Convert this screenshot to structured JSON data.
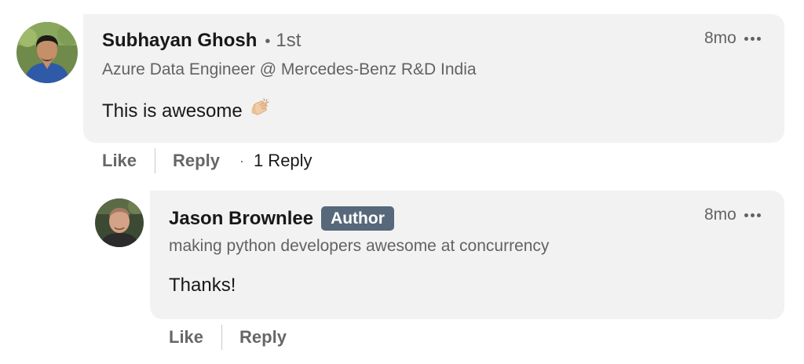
{
  "comment": {
    "author_name": "Subhayan Ghosh",
    "degree_separator": "•",
    "degree": "1st",
    "headline": "Azure Data Engineer @ Mercedes-Benz R&D India",
    "body": "This is awesome",
    "emoji": "clapping-hands-icon",
    "timestamp": "8mo",
    "actions": {
      "like_label": "Like",
      "reply_label": "Reply",
      "dot": "·",
      "reply_count_label": "1 Reply"
    }
  },
  "reply": {
    "author_name": "Jason Brownlee",
    "badge": "Author",
    "headline": "making python developers awesome at concurrency",
    "body": "Thanks!",
    "timestamp": "8mo",
    "actions": {
      "like_label": "Like",
      "reply_label": "Reply"
    }
  },
  "colors": {
    "bubble_bg": "#f2f2f2",
    "badge_bg": "#56687a",
    "secondary_text": "#666666"
  }
}
